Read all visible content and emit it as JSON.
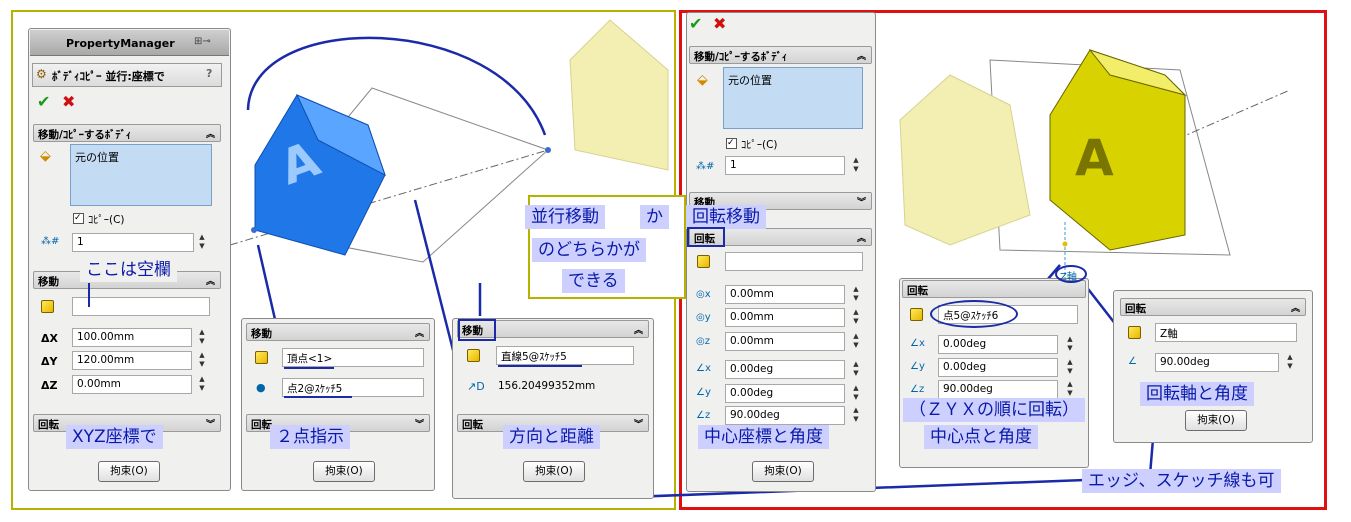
{
  "panel1": {
    "title": "PropertyManager",
    "feature": "ﾎﾞﾃﾞｨｺﾋﾟｰ 並行:座標で",
    "help": "?",
    "ok": "✔",
    "cancel": "✖",
    "bodies_section": "移動/ｺﾋﾟｰするﾎﾞﾃﾞｨ",
    "bodies_item": "元の位置",
    "copy_label": "ｺﾋﾟｰ(C)",
    "count": "1",
    "move_section": "移動",
    "dx_label": "ΔX",
    "dx": "100.00mm",
    "dy_label": "ΔY",
    "dy": "120.00mm",
    "dz_label": "ΔZ",
    "dz": "0.00mm",
    "rotate_section": "回転",
    "constraint_btn": "拘束(O)"
  },
  "panel2": {
    "move_section": "移動",
    "from": "頂点<1>",
    "to": "点2@ｽｹｯﾁ5",
    "rotate_section": "回転",
    "constraint_btn": "拘束(O)"
  },
  "panel3": {
    "move_section": "移動",
    "direction": "直線5@ｽｹｯﾁ5",
    "distance": "156.20499352mm",
    "rotate_section": "回転",
    "constraint_btn": "拘束(O)"
  },
  "panel4": {
    "ok": "✔",
    "cancel": "✖",
    "bodies_section": "移動/ｺﾋﾟｰするﾎﾞﾃﾞｨ",
    "bodies_item": "元の位置",
    "copy_label": "ｺﾋﾟｰ(C)",
    "count": "1",
    "move_section": "移動",
    "rotate_section": "回転",
    "x": "0.00mm",
    "y": "0.00mm",
    "z": "0.00mm",
    "rx": "0.00deg",
    "ry": "0.00deg",
    "rz": "90.00deg",
    "constraint_btn": "拘束(O)"
  },
  "panel5": {
    "rotate_section": "回転",
    "point": "点5@ｽｹｯﾁ6",
    "rx": "0.00deg",
    "ry": "0.00deg",
    "rz": "90.00deg",
    "constraint_btn": "拘束(O)"
  },
  "panel6": {
    "rotate_section": "回転",
    "axis": "Z軸",
    "angle": "90.00deg",
    "constraint_btn": "拘束(O)"
  },
  "annotations": {
    "blank": "ここは空欄",
    "parallel": "並行移動",
    "ka": "か",
    "rotation": "回転移動",
    "either1": "のどちらかが",
    "either2": "できる",
    "xyz": "XYZ座標で",
    "two_points": "２点指示",
    "dir_dist": "方向と距離",
    "center_angle": "中心座標と角度",
    "zyx": "（ＺＹＸの順に回転）",
    "center_point": "中心点と角度",
    "axis_angle": "回転軸と角度",
    "edge": "エッジ、スケッチ線も可",
    "zaxis_small": "Z軸"
  },
  "colors": {
    "green_frame": "#b5b300",
    "red_frame": "#e01010",
    "annotation_text": "#0a1aa8",
    "annotation_bg": "#cdd0ff",
    "blue_body": "#1f77e8",
    "yellow_body": "#d8d200"
  }
}
